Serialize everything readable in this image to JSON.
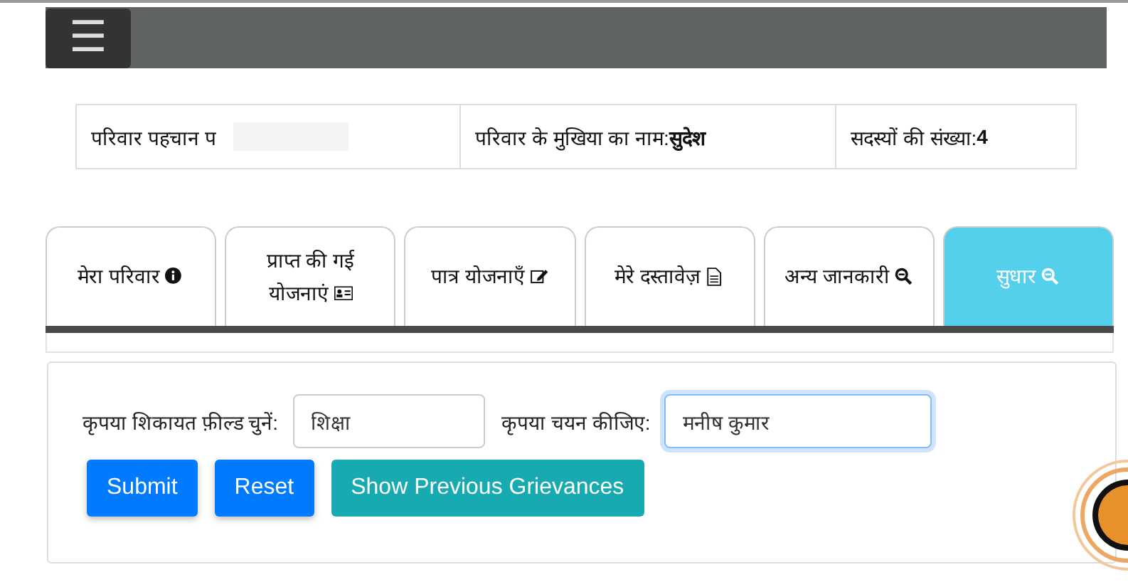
{
  "top_bar": {
    "menu_button": "☰"
  },
  "family_info": [
    {
      "label": "परिवार पहचान प",
      "redacted": true
    },
    {
      "label": "परिवार के मुखिया का नाम:",
      "value": "सुदेश",
      "redacted": false
    },
    {
      "label": "सदस्यों की संख्या:",
      "value": "4",
      "redacted": false
    }
  ],
  "tabs": [
    {
      "label": "मेरा परिवार",
      "kind": "info",
      "selected": false
    },
    {
      "label": "प्राप्त की गई योजनाएं",
      "kind": "card",
      "selected": false
    },
    {
      "label": "पात्र योजनाएँ",
      "kind": "edit",
      "selected": false
    },
    {
      "label": "मेरे दस्तावेज़",
      "kind": "doc",
      "selected": false
    },
    {
      "label": "अन्य जानकारी",
      "kind": "search",
      "selected": false
    },
    {
      "label": "सुधार",
      "kind": "search",
      "selected": true
    }
  ],
  "form": {
    "fields": [
      {
        "label": "कृपया शिकायत फ़ील्ड चुनें:",
        "value": "शिक्षा",
        "focused": false
      },
      {
        "label": "कृपया चयन कीजिए:",
        "value": "मनीष कुमार",
        "focused": true
      }
    ],
    "buttons": [
      {
        "label": "Submit",
        "kind": "primary"
      },
      {
        "label": "Reset",
        "kind": "primary"
      },
      {
        "label": "Show Previous Grievances",
        "kind": "info"
      }
    ]
  }
}
